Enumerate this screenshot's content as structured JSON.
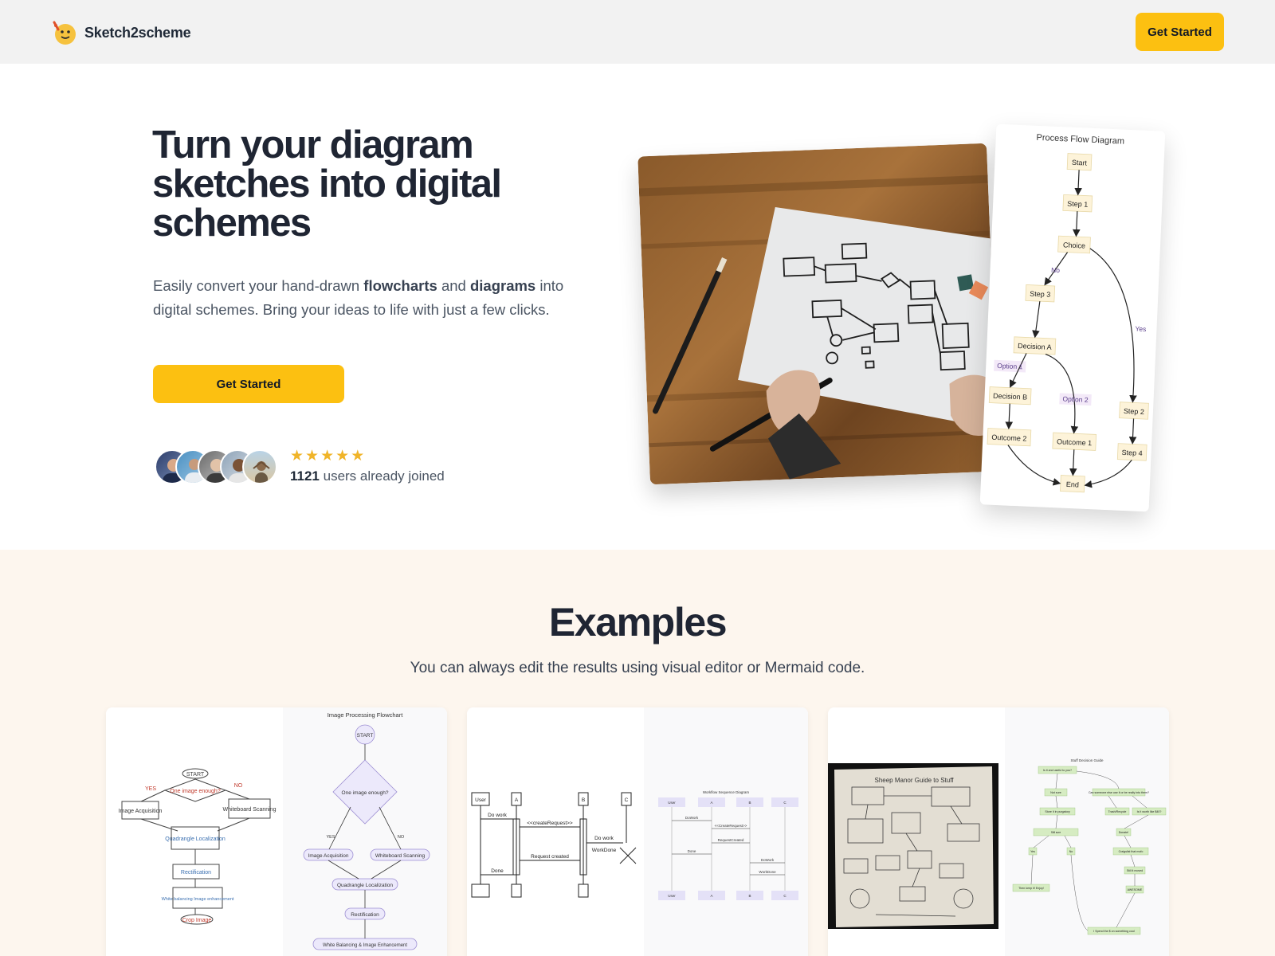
{
  "nav": {
    "brand": "Sketch2scheme",
    "cta": "Get Started"
  },
  "hero": {
    "title": "Turn your diagram sketches into digital schemes",
    "subtitle_pre": "Easily convert your hand-drawn ",
    "subtitle_b1": "flowcharts",
    "subtitle_mid": " and ",
    "subtitle_b2": "diagrams",
    "subtitle_post": " into digital schemes. Bring your ideas to life with just a few clicks.",
    "cta": "Get Started",
    "rating_stars": 5,
    "users_count": "1121",
    "users_text": " users already joined"
  },
  "flow_card": {
    "title": "Process Flow Diagram",
    "nodes": [
      "Start",
      "Step 1",
      "Choice",
      "Step 3",
      "Decision A",
      "Decision B",
      "Outcome 2",
      "Outcome 1",
      "Step 2",
      "Step 4",
      "End"
    ],
    "edge_labels": [
      "No",
      "Yes",
      "Option 1",
      "Option 2"
    ]
  },
  "examples": {
    "title": "Examples",
    "subtitle": "You can always edit the results using visual editor or Mermaid code.",
    "card1": {
      "title": "Image Processing Flowchart",
      "nodes": [
        "START",
        "One image enough?",
        "Image Acquisition",
        "Whiteboard Scanning",
        "Quadrangle Localization",
        "Rectification",
        "White Balancing & Image Enhancement"
      ],
      "edges": [
        "YES",
        "NO"
      ],
      "sketch": [
        "START",
        "One image enough?",
        "YES",
        "NO",
        "Image Acquisition",
        "Whiteboard Scanning",
        "Quadrangle Localization",
        "Rectification",
        "White balancing Image enhancement",
        "Crop Image"
      ]
    },
    "card2": {
      "title": "Workflow Sequence Diagram",
      "actors": [
        "User",
        "A",
        "B",
        "C"
      ],
      "sketch": [
        "User",
        "A",
        "B",
        "C",
        "Do work",
        "<<createRequest>>",
        "Do work",
        "Request created",
        "Done",
        "WorkDone"
      ],
      "messages": [
        "DoWork",
        "<<CreateRequest>>",
        "RequestCreated",
        "Done",
        "DoWork",
        "WorkDone"
      ]
    },
    "card3": {
      "title": "Stuff Decision Guide",
      "sketch_title": "Sheep Manor Guide to Stuff",
      "nodes": [
        "Is it and useful to you?",
        "Not sure",
        "Can someone else use it or be really into them?",
        "Store it in purgatory",
        "Trash/Recycle",
        "Is it worth like $40?",
        "Yes",
        "No",
        "Donate!",
        "Craigslist that mofo",
        "Still it moved",
        "AWESOME",
        "Then keep it! Enjoy!",
        "I Spend the $ on something cool"
      ],
      "edges": [
        "Still sure",
        "Yes",
        "No"
      ]
    }
  },
  "colors": {
    "accent": "#fcc011",
    "nav_bg": "#f2f2f2",
    "examples_bg": "#fdf6ee",
    "heading": "#1f2533",
    "star": "#f0b429"
  }
}
